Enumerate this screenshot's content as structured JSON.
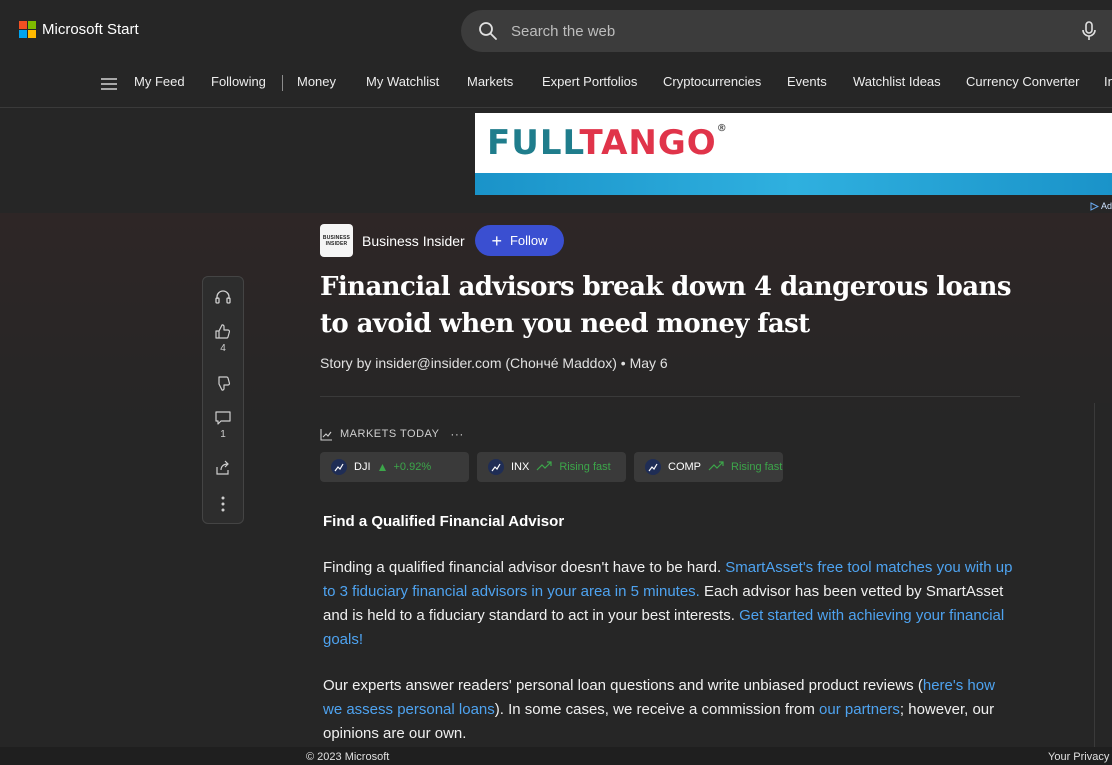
{
  "header": {
    "brand": "Microsoft Start",
    "logo_colors": [
      "#f25022",
      "#7fba00",
      "#00a4ef",
      "#ffb900"
    ],
    "search_placeholder": "Search the web"
  },
  "nav": {
    "items": [
      "My Feed",
      "Following",
      "Money",
      "My Watchlist",
      "Markets",
      "Expert Portfolios",
      "Cryptocurrencies",
      "Events",
      "Watchlist Ideas",
      "Currency Converter",
      "In"
    ]
  },
  "ad": {
    "logo_part1": "FULL",
    "logo_part2": "TANGO",
    "reg": "®",
    "choice_label": "Ad"
  },
  "rail": {
    "like_count": "4",
    "comment_count": "1"
  },
  "article": {
    "publisher_logo_line1": "BUSINESS",
    "publisher_logo_line2": "INSIDER",
    "publisher": "Business Insider",
    "follow_label": "Follow",
    "title": "Financial advisors break down 4 dangerous loans to avoid when you need money fast",
    "byline": "Story by insider@insider.com (Chончé Maddox) • May 6",
    "markets_label": "MARKETS TODAY",
    "markets_more": "···",
    "tickers": [
      {
        "symbol": "DJI",
        "value": "+0.92%"
      },
      {
        "symbol": "INX",
        "value": "Rising fast"
      },
      {
        "symbol": "COMP",
        "value": "Rising fast"
      }
    ],
    "heading": "Find a Qualified Financial Advisor",
    "p1_a": "Finding a qualified financial advisor doesn't have to be hard. ",
    "p1_link1": "SmartAsset's free tool matches you with up to 3 fiduciary financial advisors in your area in 5 minutes.",
    "p1_b": " Each advisor has been vetted by SmartAsset and is held to a fiduciary standard to act in your best interests. ",
    "p1_link2": "Get started with achieving your financial goals!",
    "p2_a": "Our experts answer readers' personal loan questions and write unbiased product reviews (",
    "p2_link1": "here's how we assess personal loans",
    "p2_b": "). In some cases, we receive a commission from ",
    "p2_link2": "our partners",
    "p2_c": "; however, our opinions are our own."
  },
  "footer": {
    "copyright": "© 2023 Microsoft",
    "privacy": "Your Privacy"
  },
  "colors": {
    "accent": "#3a4fd1",
    "link": "#4ea3f0",
    "positive": "#3ca64a"
  }
}
